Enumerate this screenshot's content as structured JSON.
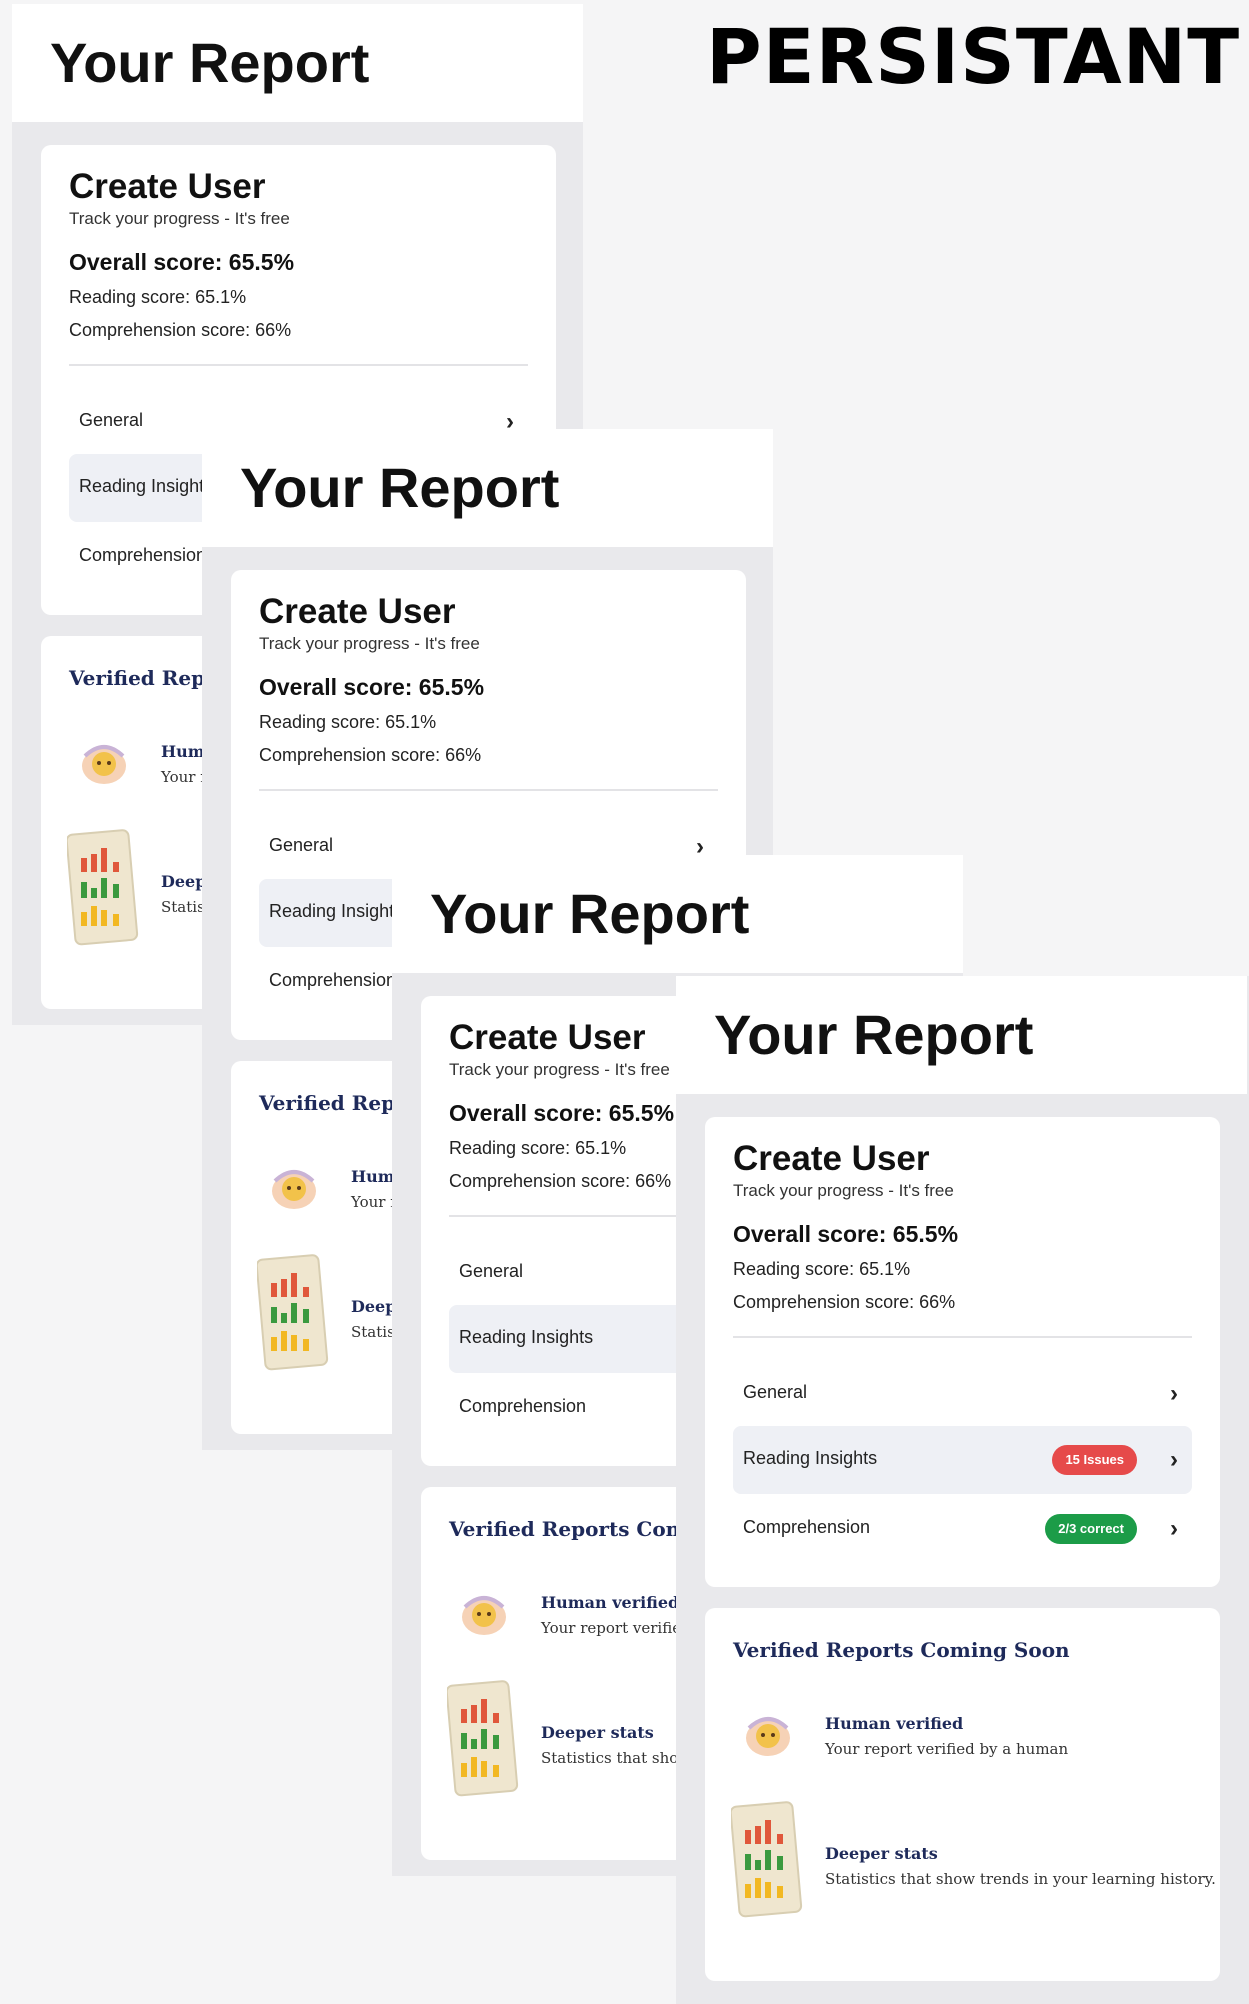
{
  "banner": "PERSISTANT",
  "report": {
    "title": "Your Report",
    "create_user": "Create User",
    "subtitle": "Track your progress - It's free",
    "overall": "Overall score: 65.5%",
    "reading": "Reading score: 65.1%",
    "comprehension": "Comprehension score: 66%",
    "nav": {
      "general": "General",
      "reading_insights": "Reading Insights",
      "comprehension": "Comprehension",
      "issues_badge": "15 Issues",
      "correct_badge": "2/3 correct"
    },
    "verified": {
      "title": "Verified Reports Coming Soon",
      "human_title": "Human verified",
      "human_desc": "Your report verified by a human",
      "stats_title": "Deeper stats",
      "stats_desc": "Statistics that show trends in your learning history."
    }
  },
  "colors": {
    "badge_red": "#e64a4a",
    "badge_green": "#1c9c48",
    "accent_navy": "#1e2a5a"
  }
}
